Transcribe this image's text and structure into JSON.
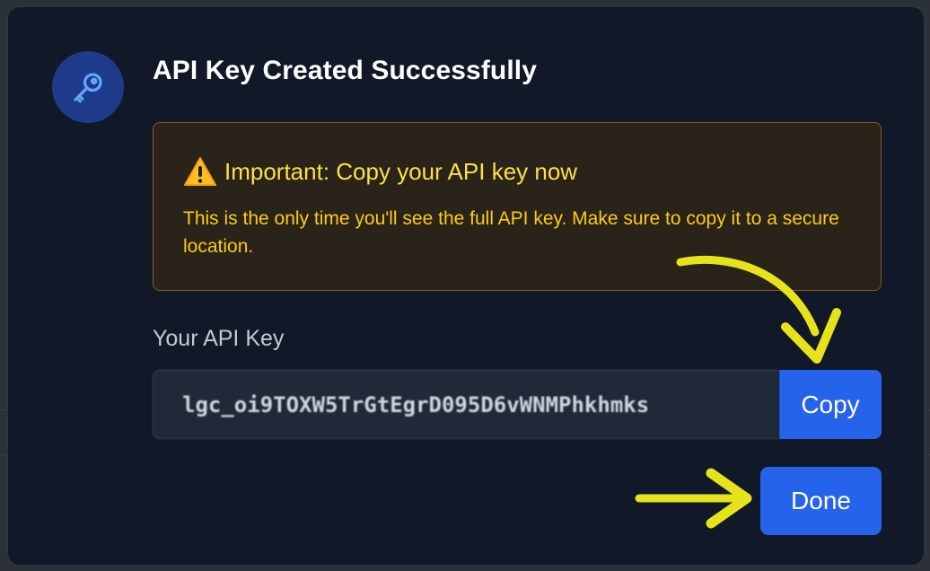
{
  "dialog": {
    "title": "API Key Created Successfully",
    "icon": "key-icon"
  },
  "warning": {
    "icon": "warning-icon",
    "title": "Important: Copy your API key now",
    "body": "This is the only time you'll see the full API key. Make sure to copy it to a secure location."
  },
  "api_key": {
    "label": "Your API Key",
    "value": "lgc_oi9TOXW5TrGtEgrD095D6vWNMPhkhmks",
    "copy_label": "Copy"
  },
  "actions": {
    "done_label": "Done"
  },
  "colors": {
    "accent": "#2563eb",
    "warning_text": "#facc15",
    "annotation_arrow": "#e6e31a"
  }
}
